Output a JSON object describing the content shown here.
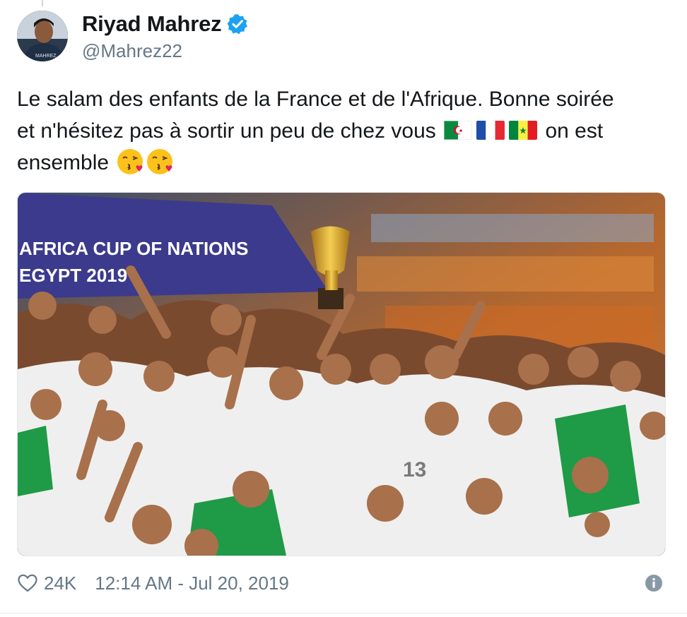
{
  "user": {
    "display_name": "Riyad Mahrez",
    "handle": "@Mahrez22",
    "verified": true
  },
  "tweet": {
    "text_line1": "Le salam des enfants de la France et de l'Afrique. Bonne soirée",
    "text_line2": "et n'hésitez pas à sortir un peu de chez vous",
    "text_line2_tail": "on est",
    "text_line3": "ensemble",
    "flags": [
      "algeria-flag",
      "france-flag",
      "senegal-flag"
    ],
    "emoji": [
      "face-blowing-kiss",
      "face-blowing-kiss"
    ]
  },
  "media": {
    "banner_line1": "AFRICA CUP OF NATIONS",
    "banner_line2": "EGYPT 2019",
    "jersey_number": "13"
  },
  "footer": {
    "like_count": "24K",
    "timestamp": "12:14 AM - Jul 20, 2019"
  },
  "colors": {
    "verified": "#1da1f2",
    "secondary_text": "#657786",
    "primary_text": "#14171a"
  }
}
